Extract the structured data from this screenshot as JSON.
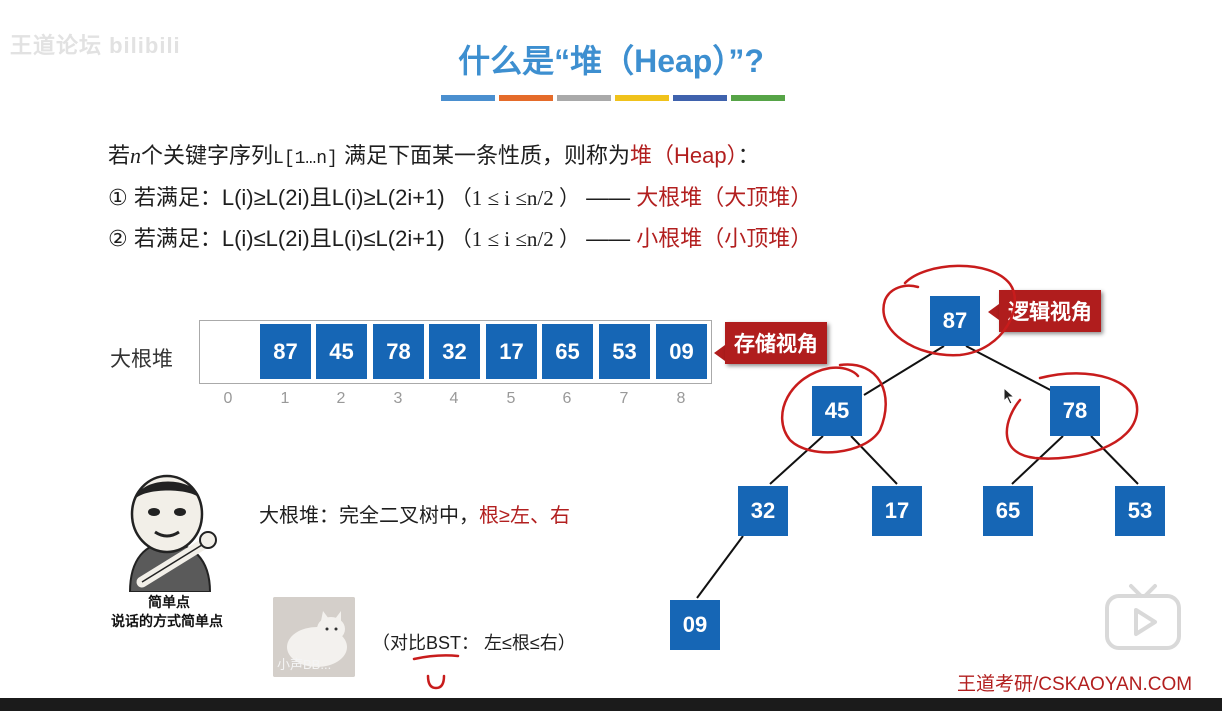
{
  "watermark": "王道论坛 bilibili",
  "title": "什么是“堆（Heap）”?",
  "colors": {
    "title_blue": "#3d8fd0",
    "node_blue": "#1666b5",
    "accent_red": "#b21f1f",
    "callout_red": "#b01d1d",
    "stripes": [
      "#4a8fcf",
      "#e56b2a",
      "#a9a9a9",
      "#f0c21b",
      "#3f62ad",
      "#56a447"
    ]
  },
  "definition": {
    "line1": {
      "p1": "若",
      "n": "n",
      "p2": "个关键字序列",
      "code": "L[1…n]",
      "p3": " 满足下面某一条性质，则称为",
      "term": "堆（Heap）",
      "p4": "："
    },
    "line2": {
      "prefix": "① 若满足：L(i)≥L(2i)且L(i)≥L(2i+1)",
      "range": "（1 ≤ i ≤n/2 ）",
      "dash": "—— ",
      "result": "大根堆（大顶堆）"
    },
    "line3": {
      "prefix": "② 若满足：L(i)≤L(2i)且L(i)≤L(2i+1)",
      "range": "（1 ≤ i ≤n/2 ）",
      "dash": "—— ",
      "result": "小根堆（小顶堆）"
    }
  },
  "array": {
    "label": "大根堆",
    "values": [
      "",
      "87",
      "45",
      "78",
      "32",
      "17",
      "65",
      "53",
      "09"
    ],
    "indices": [
      "0",
      "1",
      "2",
      "3",
      "4",
      "5",
      "6",
      "7",
      "8"
    ]
  },
  "callouts": {
    "storage": "存储视角",
    "logic": "逻辑视角"
  },
  "tree": {
    "nodes": [
      "87",
      "45",
      "78",
      "32",
      "17",
      "65",
      "53",
      "09"
    ]
  },
  "caption": {
    "prefix": "大根堆：完全二叉树中，",
    "highlight": "根≥左、右"
  },
  "meme": {
    "line1": "简单点",
    "line2": "说话的方式简单点"
  },
  "cat_label": "小声BB...",
  "bst_note": "（对比BST：  左≤根≤右）",
  "site": "王道考研/CSKAOYAN.COM",
  "icons": {
    "play": "play-icon",
    "cursor": "cursor-icon"
  }
}
